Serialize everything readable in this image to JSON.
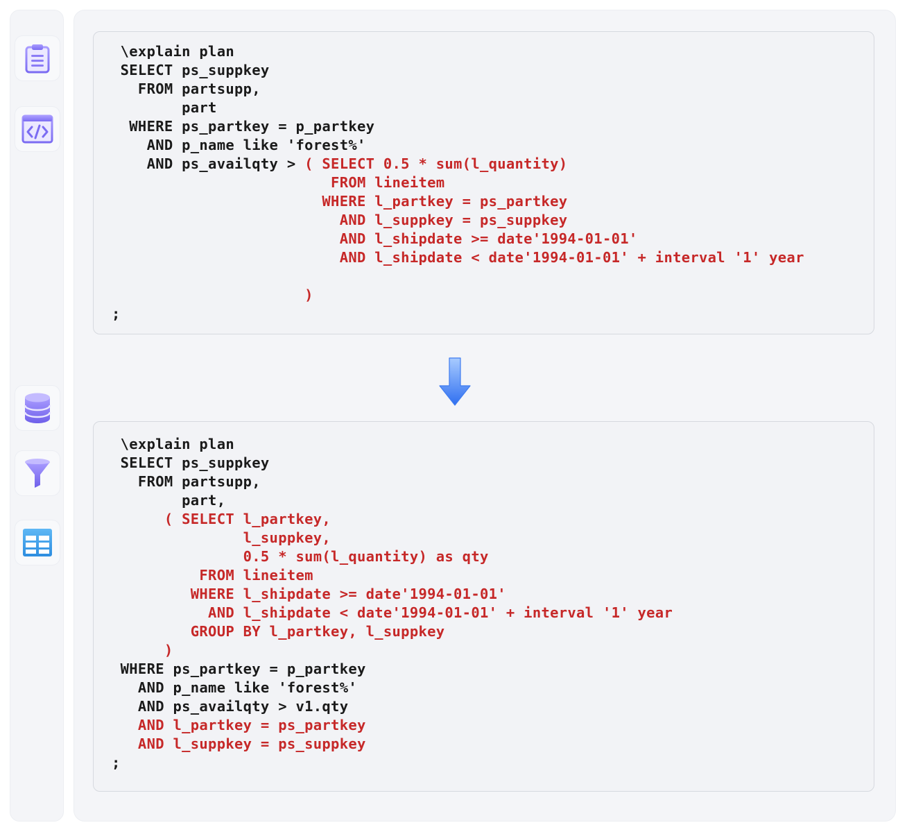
{
  "sidebar": {
    "top_icons": [
      "clipboard-icon",
      "code-window-icon"
    ],
    "bottom_icons": [
      "database-icon",
      "filter-icon",
      "table-icon"
    ]
  },
  "colors": {
    "keyword_dark": "#1a1a1a",
    "highlight_red": "#c62828",
    "accent_purple": "#8b7cf6",
    "accent_blue": "#3b82f6"
  },
  "original_query": {
    "lines": [
      {
        "text": " \\explain plan",
        "color": "dark"
      },
      {
        "text": " SELECT ps_suppkey",
        "color": "dark"
      },
      {
        "text": "   FROM partsupp,",
        "color": "dark"
      },
      {
        "text": "        part",
        "color": "dark"
      },
      {
        "text": "  WHERE ps_partkey = p_partkey",
        "color": "dark"
      },
      {
        "text": "    AND p_name like 'forest%'",
        "color": "dark"
      },
      {
        "text": "    AND ps_availqty > ",
        "color": "dark",
        "tail": "( SELECT 0.5 * sum(l_quantity)"
      },
      {
        "text": "                         FROM lineitem",
        "color": "red"
      },
      {
        "text": "                        WHERE l_partkey = ps_partkey",
        "color": "red"
      },
      {
        "text": "                          AND l_suppkey = ps_suppkey",
        "color": "red"
      },
      {
        "text": "                          AND l_shipdate >= date'1994-01-01'",
        "color": "red"
      },
      {
        "text": "                          AND l_shipdate < date'1994-01-01' + interval '1' year",
        "color": "red"
      },
      {
        "text": "",
        "color": "red"
      },
      {
        "text": "                      )",
        "color": "red"
      },
      {
        "text": ";",
        "color": "dark"
      }
    ]
  },
  "rewritten_query": {
    "lines": [
      {
        "text": " \\explain plan",
        "color": "dark"
      },
      {
        "text": " SELECT ps_suppkey",
        "color": "dark"
      },
      {
        "text": "   FROM partsupp,",
        "color": "dark"
      },
      {
        "text": "        part,",
        "color": "dark"
      },
      {
        "text": "      ( SELECT l_partkey,",
        "color": "red"
      },
      {
        "text": "               l_suppkey,",
        "color": "red"
      },
      {
        "text": "               0.5 * sum(l_quantity) as qty",
        "color": "red"
      },
      {
        "text": "          FROM lineitem",
        "color": "red"
      },
      {
        "text": "         WHERE l_shipdate >= date'1994-01-01'",
        "color": "red"
      },
      {
        "text": "           AND l_shipdate < date'1994-01-01' + interval '1' year",
        "color": "red"
      },
      {
        "text": "         GROUP BY l_partkey, l_suppkey",
        "color": "red"
      },
      {
        "text": "      )",
        "color": "red"
      },
      {
        "text": " WHERE ps_partkey = p_partkey",
        "color": "dark"
      },
      {
        "text": "   AND p_name like 'forest%'",
        "color": "dark"
      },
      {
        "text": "   AND ps_availqty > v1.qty",
        "color": "dark"
      },
      {
        "text": "   AND l_partkey = ps_partkey",
        "color": "red"
      },
      {
        "text": "   AND l_suppkey = ps_suppkey",
        "color": "red"
      },
      {
        "text": ";",
        "color": "dark"
      }
    ]
  }
}
